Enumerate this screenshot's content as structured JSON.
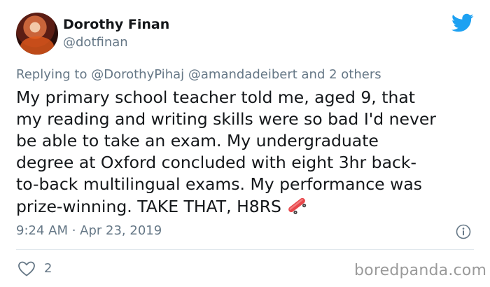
{
  "tweet": {
    "author_name": "Dorothy Finan",
    "author_handle": "@dotfinan",
    "replying_prefix": "Replying to",
    "replying_to": [
      "@DorothyPihaj",
      "@amandadeibert"
    ],
    "replying_suffix": "and 2 others",
    "text": "My primary school teacher told me, aged 9, that\nmy reading and writing skills were so bad I'd never\nbe able to take an exam. My undergraduate\ndegree at Oxford concluded with eight 3hr back-\nto-back multilingual exams. My performance was\nprize-winning. TAKE THAT, H8RS",
    "emoji": "skateboard",
    "timestamp": "9:24 AM · Apr 23, 2019",
    "like_count": "2"
  },
  "icons": {
    "brand": "twitter-bird-icon",
    "info": "info-icon",
    "like": "heart-icon"
  },
  "colors": {
    "twitter_blue": "#1da1f2",
    "secondary_text": "#657786",
    "primary_text": "#14171a"
  },
  "watermark": "boredpanda.com"
}
